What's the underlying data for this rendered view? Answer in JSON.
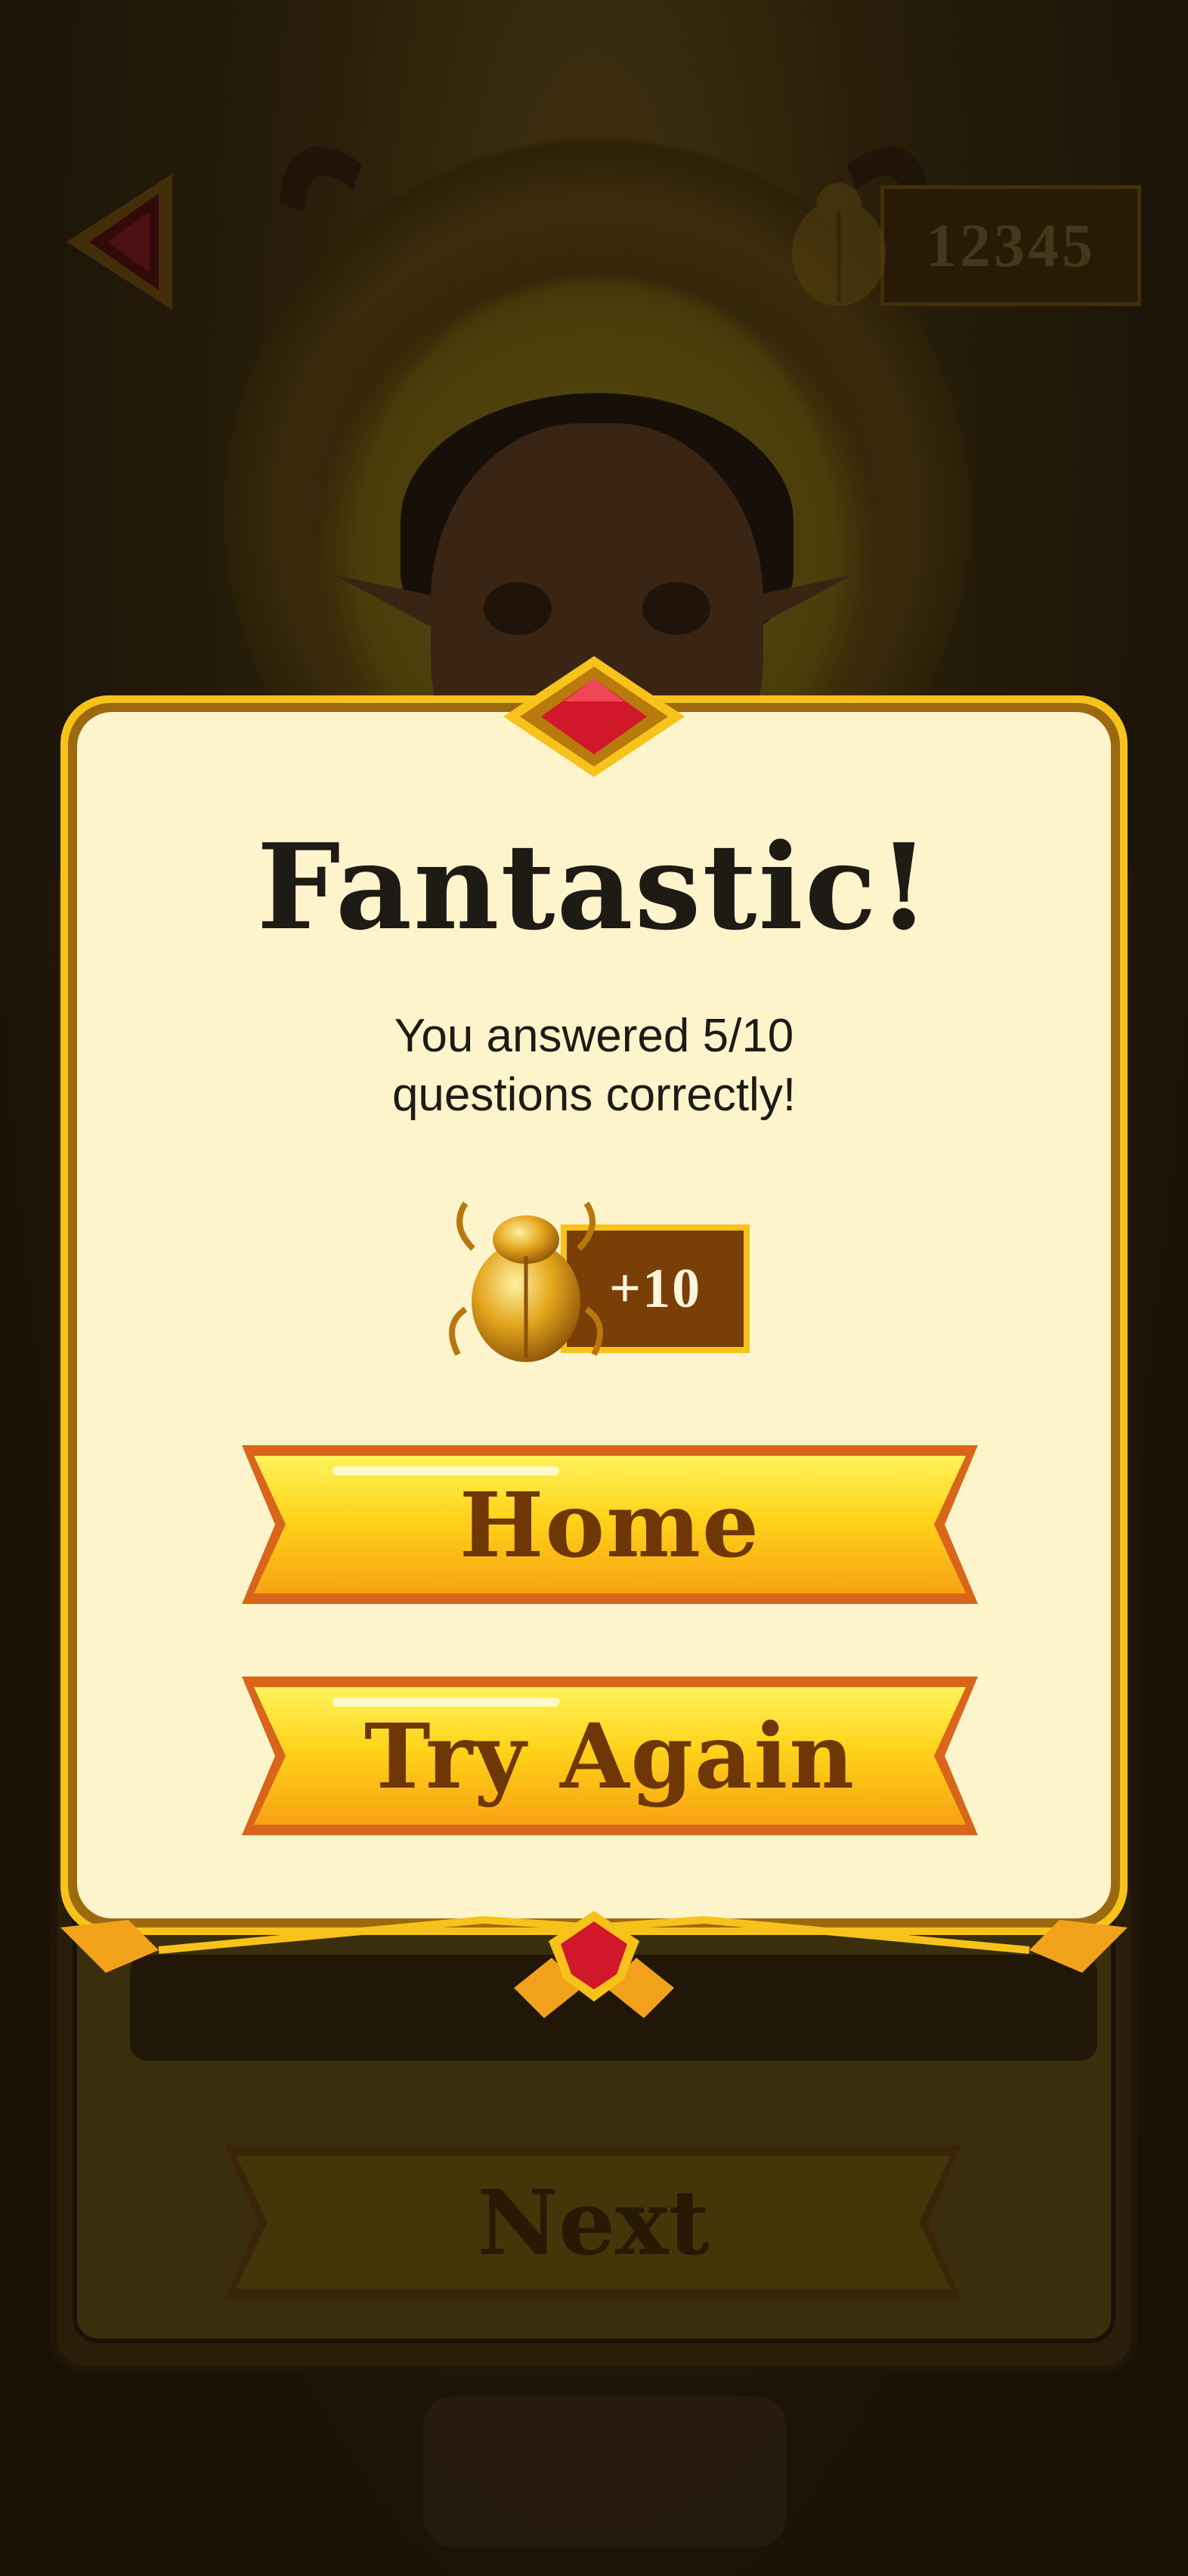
{
  "header": {
    "coin_count": "12345",
    "back_icon": "back-arrow-gem-icon",
    "coin_icon": "scarab-icon"
  },
  "modal": {
    "title": "Fantastic!",
    "message_line1": "You answered 5/10",
    "message_line2": "questions correctly!",
    "reward": {
      "icon": "scarab-icon",
      "value": "+10"
    },
    "buttons": {
      "home": "Home",
      "try_again": "Try Again"
    }
  },
  "background_panel": {
    "next_label": "Next"
  },
  "colors": {
    "card": "#fef4cc",
    "frame_gold": "#f7c21a",
    "button_text": "#6f3606",
    "gem_red": "#d0182a"
  }
}
